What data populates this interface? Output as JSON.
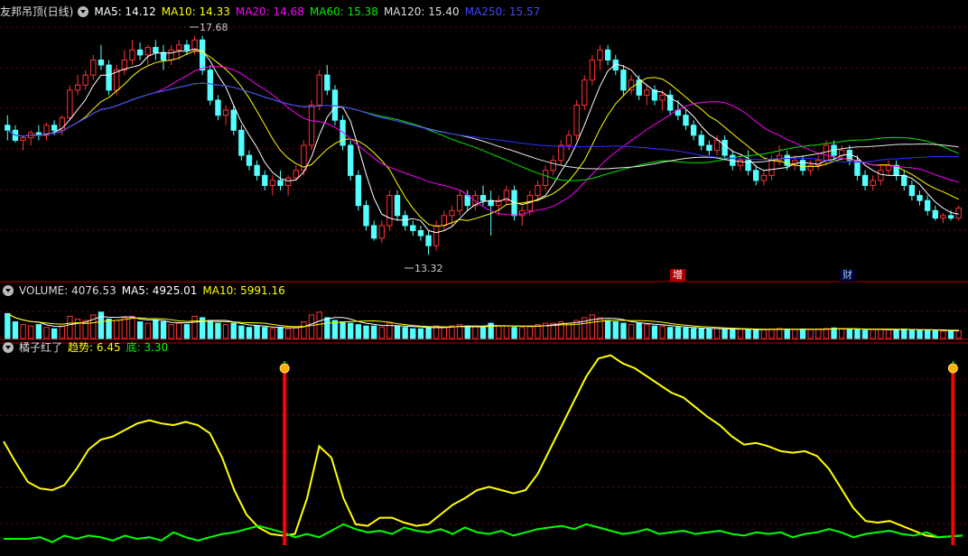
{
  "header_price": {
    "title": "友邦吊顶(日线)",
    "ma5": "MA5: 14.12",
    "ma10": "MA10: 14.33",
    "ma20": "MA20: 14.68",
    "ma60": "MA60: 15.38",
    "ma120": "MA120: 15.40",
    "ma250": "MA250: 15.57"
  },
  "header_volume": {
    "title": "VOLUME: 4076.53",
    "ma5": "MA5: 4925.01",
    "ma10": "MA10: 5991.16"
  },
  "header_indicator": {
    "title": "橘子红了",
    "trend": "趋势: 6.45",
    "bottom": "底: 3.30"
  },
  "annotations": {
    "high": "17.68",
    "low": "13.32",
    "event1": "增",
    "event2": "财"
  },
  "colors": {
    "up": "#ff3232",
    "down": "#54ffff",
    "ma5": "#ffffff",
    "ma10": "#ffff00",
    "ma20": "#ff00ff",
    "ma60": "#00e600",
    "ma120": "#e6e6e6",
    "ma250": "#3232ff",
    "trend": "#ffff00",
    "bottom": "#00ff00",
    "signal": "#ff0000",
    "grid": "#800000"
  },
  "chart_data": [
    {
      "type": "candlestick",
      "title": "友邦吊顶(日线)",
      "ylim": [
        13.0,
        18.0
      ],
      "high_label": 17.68,
      "low_label": 13.32,
      "ohlc": [
        [
          15.9,
          16.1,
          15.6,
          15.8
        ],
        [
          15.8,
          15.9,
          15.55,
          15.6
        ],
        [
          15.6,
          15.7,
          15.4,
          15.65
        ],
        [
          15.65,
          15.8,
          15.5,
          15.75
        ],
        [
          15.75,
          15.9,
          15.6,
          15.7
        ],
        [
          15.7,
          15.95,
          15.6,
          15.9
        ],
        [
          15.9,
          16.0,
          15.7,
          15.8
        ],
        [
          15.8,
          16.1,
          15.7,
          16.05
        ],
        [
          16.05,
          16.7,
          16.0,
          16.6
        ],
        [
          16.6,
          16.9,
          16.5,
          16.7
        ],
        [
          16.7,
          17.0,
          16.6,
          16.9
        ],
        [
          16.9,
          17.3,
          16.8,
          17.2
        ],
        [
          17.2,
          17.5,
          17.0,
          17.1
        ],
        [
          17.1,
          17.2,
          16.5,
          16.6
        ],
        [
          16.6,
          17.1,
          16.5,
          17.0
        ],
        [
          17.0,
          17.4,
          16.9,
          17.2
        ],
        [
          17.2,
          17.6,
          17.1,
          17.4
        ],
        [
          17.4,
          17.55,
          17.2,
          17.3
        ],
        [
          17.3,
          17.5,
          17.1,
          17.45
        ],
        [
          17.45,
          17.6,
          17.2,
          17.35
        ],
        [
          17.35,
          17.5,
          17.0,
          17.2
        ],
        [
          17.2,
          17.5,
          17.1,
          17.4
        ],
        [
          17.4,
          17.6,
          17.2,
          17.5
        ],
        [
          17.5,
          17.6,
          17.3,
          17.4
        ],
        [
          17.4,
          17.68,
          17.3,
          17.6
        ],
        [
          17.6,
          17.68,
          16.9,
          17.0
        ],
        [
          17.0,
          17.1,
          16.3,
          16.4
        ],
        [
          16.4,
          16.5,
          16.0,
          16.1
        ],
        [
          16.1,
          16.3,
          15.9,
          16.2
        ],
        [
          16.2,
          16.3,
          15.7,
          15.8
        ],
        [
          15.8,
          15.9,
          15.2,
          15.3
        ],
        [
          15.3,
          15.4,
          15.0,
          15.1
        ],
        [
          15.1,
          15.2,
          14.8,
          14.9
        ],
        [
          14.9,
          15.0,
          14.6,
          14.7
        ],
        [
          14.7,
          14.9,
          14.5,
          14.8
        ],
        [
          14.8,
          15.0,
          14.6,
          14.7
        ],
        [
          14.7,
          14.9,
          14.5,
          14.85
        ],
        [
          14.85,
          15.1,
          14.8,
          15.0
        ],
        [
          15.0,
          15.6,
          14.9,
          15.5
        ],
        [
          15.5,
          16.4,
          15.4,
          16.3
        ],
        [
          16.3,
          17.0,
          16.2,
          16.9
        ],
        [
          16.9,
          17.1,
          16.5,
          16.6
        ],
        [
          16.6,
          16.7,
          15.9,
          16.0
        ],
        [
          16.0,
          16.1,
          15.4,
          15.5
        ],
        [
          15.5,
          15.6,
          14.8,
          14.9
        ],
        [
          14.9,
          15.0,
          14.2,
          14.3
        ],
        [
          14.3,
          14.4,
          13.8,
          13.9
        ],
        [
          13.9,
          14.0,
          13.6,
          13.65
        ],
        [
          13.65,
          14.0,
          13.55,
          13.9
        ],
        [
          13.9,
          14.6,
          13.8,
          14.5
        ],
        [
          14.5,
          14.6,
          14.0,
          14.1
        ],
        [
          14.1,
          14.2,
          13.8,
          13.9
        ],
        [
          13.9,
          14.0,
          13.7,
          13.8
        ],
        [
          13.8,
          13.9,
          13.6,
          13.7
        ],
        [
          13.7,
          13.8,
          13.32,
          13.5
        ],
        [
          13.5,
          14.0,
          13.4,
          13.9
        ],
        [
          13.9,
          14.2,
          13.8,
          14.1
        ],
        [
          14.1,
          14.3,
          13.9,
          14.2
        ],
        [
          14.2,
          14.6,
          14.1,
          14.5
        ],
        [
          14.5,
          14.6,
          14.2,
          14.3
        ],
        [
          14.3,
          14.6,
          14.2,
          14.5
        ],
        [
          14.5,
          14.7,
          14.3,
          14.4
        ],
        [
          14.4,
          14.6,
          13.7,
          14.3
        ],
        [
          14.3,
          14.5,
          14.1,
          14.4
        ],
        [
          14.4,
          14.7,
          14.3,
          14.6
        ],
        [
          14.6,
          14.7,
          14.0,
          14.1
        ],
        [
          14.1,
          14.3,
          13.9,
          14.2
        ],
        [
          14.2,
          14.6,
          14.1,
          14.5
        ],
        [
          14.5,
          14.8,
          14.4,
          14.7
        ],
        [
          14.7,
          15.1,
          14.6,
          15.0
        ],
        [
          15.0,
          15.3,
          14.9,
          15.2
        ],
        [
          15.2,
          15.6,
          15.1,
          15.5
        ],
        [
          15.5,
          15.8,
          15.4,
          15.7
        ],
        [
          15.7,
          16.4,
          15.6,
          16.3
        ],
        [
          16.3,
          16.9,
          16.2,
          16.8
        ],
        [
          16.8,
          17.3,
          16.7,
          17.2
        ],
        [
          17.2,
          17.5,
          17.0,
          17.4
        ],
        [
          17.4,
          17.5,
          17.1,
          17.2
        ],
        [
          17.2,
          17.3,
          16.9,
          17.0
        ],
        [
          17.0,
          17.1,
          16.5,
          16.6
        ],
        [
          16.6,
          16.9,
          16.5,
          16.8
        ],
        [
          16.8,
          16.9,
          16.4,
          16.5
        ],
        [
          16.5,
          16.7,
          16.3,
          16.6
        ],
        [
          16.6,
          16.7,
          16.3,
          16.4
        ],
        [
          16.4,
          16.6,
          16.2,
          16.5
        ],
        [
          16.5,
          16.6,
          16.1,
          16.2
        ],
        [
          16.2,
          16.4,
          16.0,
          16.1
        ],
        [
          16.1,
          16.2,
          15.8,
          15.9
        ],
        [
          15.9,
          16.0,
          15.6,
          15.7
        ],
        [
          15.7,
          15.8,
          15.4,
          15.5
        ],
        [
          15.5,
          15.6,
          15.3,
          15.4
        ],
        [
          15.4,
          15.7,
          15.3,
          15.6
        ],
        [
          15.6,
          15.7,
          15.2,
          15.3
        ],
        [
          15.3,
          15.4,
          15.0,
          15.1
        ],
        [
          15.1,
          15.3,
          15.0,
          15.2
        ],
        [
          15.2,
          15.4,
          14.9,
          15.0
        ],
        [
          15.0,
          15.1,
          14.7,
          14.8
        ],
        [
          14.8,
          15.0,
          14.7,
          14.9
        ],
        [
          14.9,
          15.3,
          14.8,
          15.2
        ],
        [
          15.2,
          15.5,
          15.1,
          15.3
        ],
        [
          15.3,
          15.4,
          15.0,
          15.1
        ],
        [
          15.1,
          15.3,
          15.0,
          15.2
        ],
        [
          15.2,
          15.3,
          14.9,
          15.0
        ],
        [
          15.0,
          15.2,
          14.9,
          15.1
        ],
        [
          15.1,
          15.3,
          15.0,
          15.2
        ],
        [
          15.2,
          15.6,
          15.1,
          15.5
        ],
        [
          15.5,
          15.6,
          15.2,
          15.3
        ],
        [
          15.3,
          15.5,
          15.2,
          15.4
        ],
        [
          15.4,
          15.5,
          15.1,
          15.2
        ],
        [
          15.2,
          15.3,
          14.8,
          14.9
        ],
        [
          14.9,
          15.0,
          14.6,
          14.7
        ],
        [
          14.7,
          14.9,
          14.6,
          14.8
        ],
        [
          14.8,
          15.1,
          14.7,
          15.0
        ],
        [
          15.0,
          15.2,
          14.9,
          15.1
        ],
        [
          15.1,
          15.2,
          14.8,
          14.9
        ],
        [
          14.9,
          15.0,
          14.6,
          14.7
        ],
        [
          14.7,
          14.8,
          14.4,
          14.5
        ],
        [
          14.5,
          14.6,
          14.3,
          14.4
        ],
        [
          14.4,
          14.5,
          14.1,
          14.2
        ],
        [
          14.2,
          14.3,
          14.0,
          14.05
        ],
        [
          14.05,
          14.15,
          13.95,
          14.1
        ],
        [
          14.1,
          14.2,
          14.0,
          14.05
        ],
        [
          14.05,
          14.3,
          14.0,
          14.25
        ]
      ]
    },
    {
      "type": "bar",
      "title": "VOLUME",
      "ylim": [
        0,
        14000
      ],
      "values": [
        9000,
        6000,
        5000,
        4500,
        5000,
        4000,
        3500,
        4500,
        8000,
        7000,
        6500,
        8500,
        9500,
        7000,
        6500,
        7500,
        8000,
        6000,
        5500,
        6500,
        6000,
        5000,
        5500,
        5000,
        8000,
        7500,
        6500,
        5500,
        5000,
        5500,
        4500,
        4000,
        4500,
        4000,
        3500,
        4000,
        3500,
        4000,
        6000,
        8500,
        9500,
        7500,
        6500,
        6000,
        5500,
        5000,
        4500,
        4500,
        4000,
        5500,
        4500,
        4000,
        3500,
        3500,
        4000,
        4500,
        4000,
        4500,
        5000,
        4500,
        4500,
        4000,
        5500,
        4500,
        4500,
        4000,
        4000,
        4500,
        5000,
        5500,
        5500,
        6000,
        5500,
        6500,
        7500,
        8500,
        7500,
        6500,
        6000,
        5500,
        5000,
        5500,
        5000,
        4500,
        4500,
        4000,
        4000,
        3800,
        3600,
        3500,
        3400,
        3600,
        3400,
        3200,
        3400,
        3200,
        3000,
        3200,
        3400,
        3600,
        3400,
        3200,
        3400,
        3200,
        3400,
        3600,
        3800,
        3600,
        3400,
        3200,
        3000,
        3200,
        3400,
        3200,
        3000,
        3400,
        3200,
        3000,
        3000,
        2800,
        2700,
        2600,
        2700
      ],
      "up_flags_source": "close>=open from price series"
    },
    {
      "type": "line",
      "title": "橘子红了",
      "ylim": [
        0,
        12
      ],
      "series": [
        {
          "name": "趋势",
          "values": [
            6.5,
            5.2,
            4.0,
            3.6,
            3.5,
            3.8,
            4.8,
            6.0,
            6.6,
            6.8,
            7.2,
            7.6,
            7.8,
            7.6,
            7.5,
            7.7,
            7.5,
            7.0,
            5.5,
            3.5,
            2.0,
            1.2,
            0.8,
            0.7,
            0.8,
            3.0,
            6.2,
            5.5,
            3.0,
            1.4,
            1.3,
            1.8,
            1.8,
            1.5,
            1.3,
            1.4,
            2.0,
            2.6,
            3.0,
            3.5,
            3.7,
            3.5,
            3.3,
            3.5,
            4.5,
            6.0,
            7.5,
            9.0,
            10.5,
            11.6,
            11.8,
            11.3,
            11.0,
            10.5,
            10.0,
            9.5,
            9.2,
            8.6,
            8.0,
            7.5,
            6.8,
            6.3,
            6.4,
            6.2,
            5.9,
            5.8,
            5.9,
            5.6,
            4.8,
            3.6,
            2.4,
            1.6,
            1.5,
            1.6,
            1.3,
            1.0,
            0.7,
            0.6,
            0.65,
            0.7
          ]
        },
        {
          "name": "底",
          "values": [
            0.5,
            0.5,
            0.5,
            0.6,
            0.3,
            0.7,
            0.5,
            0.7,
            0.6,
            0.4,
            0.7,
            0.5,
            0.6,
            0.4,
            0.9,
            0.6,
            0.4,
            0.6,
            0.8,
            0.9,
            1.1,
            1.3,
            1.1,
            0.9,
            0.6,
            0.8,
            0.6,
            1.0,
            1.4,
            1.1,
            0.9,
            1.0,
            0.8,
            1.2,
            1.0,
            0.9,
            1.1,
            0.8,
            1.2,
            0.9,
            0.8,
            1.0,
            0.7,
            0.9,
            1.1,
            1.2,
            1.3,
            1.1,
            1.4,
            1.2,
            1.0,
            0.8,
            0.9,
            1.1,
            0.8,
            0.9,
            1.0,
            0.8,
            0.9,
            1.0,
            0.8,
            0.7,
            0.9,
            0.8,
            0.9,
            0.6,
            0.8,
            0.9,
            1.1,
            0.9,
            0.6,
            0.8,
            0.9,
            1.0,
            0.8,
            0.7,
            0.9,
            0.6,
            0.65,
            0.7
          ]
        }
      ],
      "signals_at_fraction": [
        0.293,
        0.99
      ]
    }
  ]
}
